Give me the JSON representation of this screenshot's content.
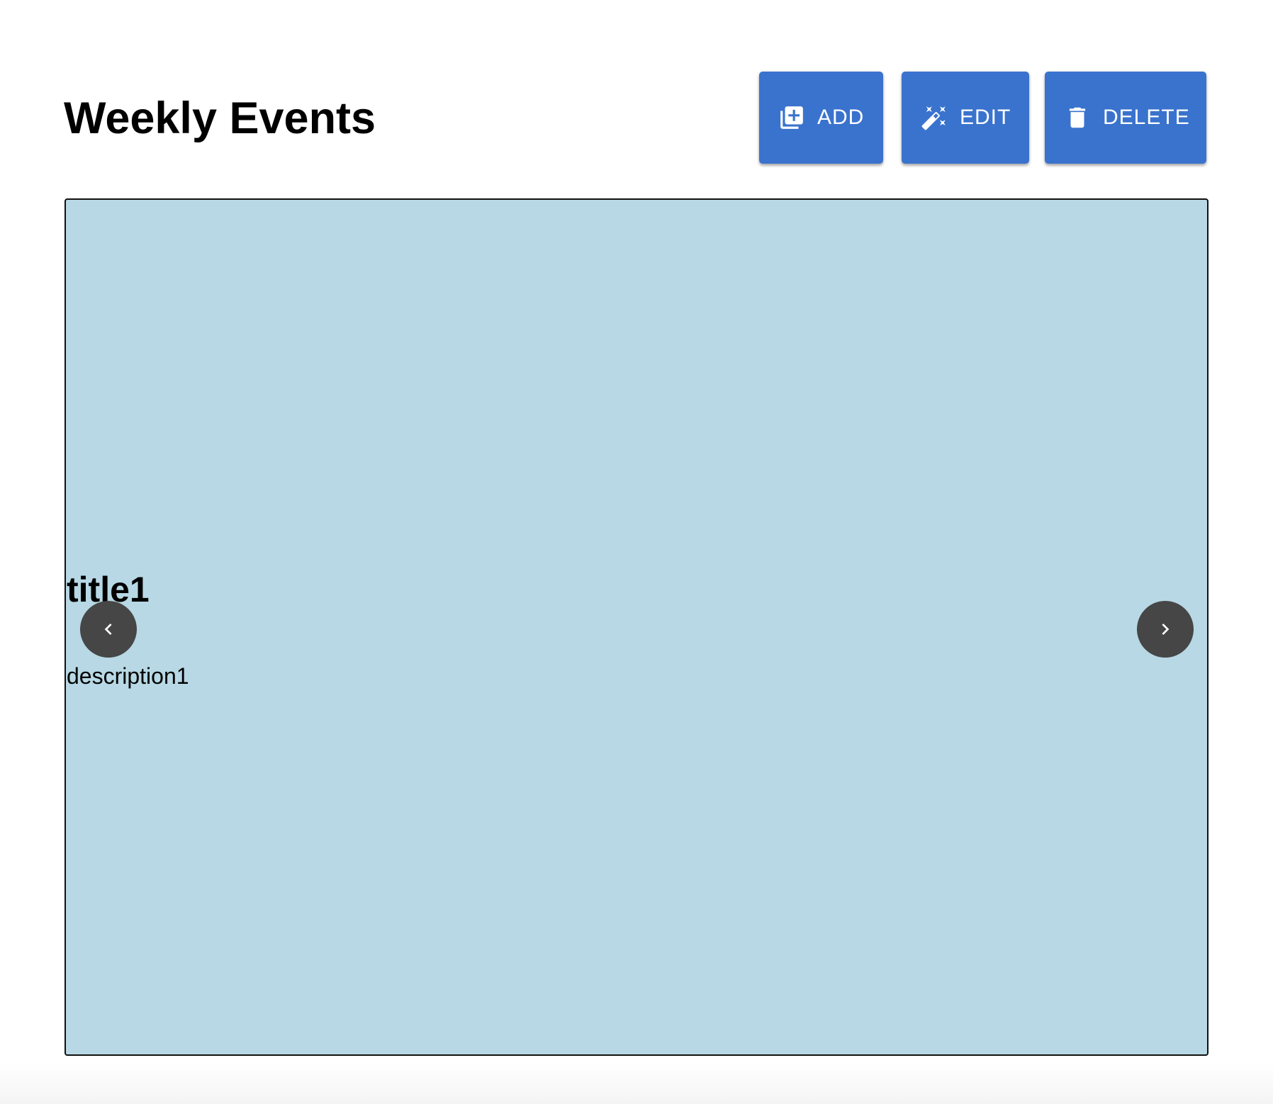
{
  "header": {
    "title": "Weekly Events"
  },
  "toolbar": {
    "add": {
      "label": "ADD",
      "icon": "library-add-icon"
    },
    "edit": {
      "label": "EDIT",
      "icon": "magic-wand-icon"
    },
    "delete": {
      "label": "DELETE",
      "icon": "trash-icon"
    }
  },
  "carousel": {
    "current_slide": {
      "title": "title1",
      "description": "description1"
    },
    "prev_icon": "chevron-left-icon",
    "next_icon": "chevron-right-icon"
  },
  "colors": {
    "button_bg": "#3a73cd",
    "slide_bg": "#b7d8e4",
    "nav_bg": "#464646"
  }
}
